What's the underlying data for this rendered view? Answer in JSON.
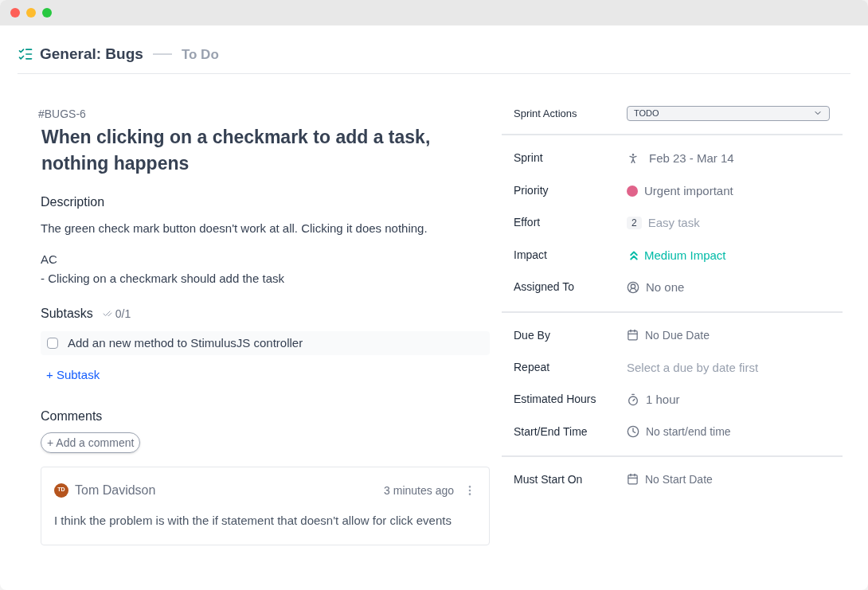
{
  "header": {
    "title": "General: Bugs",
    "status": "To Do"
  },
  "task": {
    "key": "#BUGS-6",
    "title": "When clicking on a checkmark to add a task, nothing happens",
    "description_heading": "Description",
    "description": [
      "The green check mark button doesn't work at all. Clicking it does nothing.",
      "AC",
      "- Clicking on a checkmark should add the task"
    ]
  },
  "subtasks": {
    "heading": "Subtasks",
    "count": "0/1",
    "items": [
      {
        "label": "Add an new method to StimulusJS controller",
        "checked": false
      }
    ],
    "add_button": "+ Subtask"
  },
  "comments": {
    "heading": "Comments",
    "add_button": "+ Add a comment",
    "items": [
      {
        "initials": "TD",
        "author": "Tom Davidson",
        "time": "3 minutes ago",
        "text": "I think the problem is with the if statement that doesn't allow for click events"
      }
    ]
  },
  "sprint_actions": {
    "label": "Sprint Actions",
    "value": "TODO"
  },
  "property_groups": [
    [
      {
        "kind": "sprint",
        "label": "Sprint",
        "value": "Feb 23 - Mar 14"
      },
      {
        "kind": "priority",
        "label": "Priority",
        "value": "Urgent important",
        "color": "#e0638a"
      },
      {
        "kind": "effort",
        "label": "Effort",
        "badge": "2",
        "value": "Easy task"
      },
      {
        "kind": "impact",
        "label": "Impact",
        "value": "Medium Impact"
      },
      {
        "kind": "assignee",
        "label": "Assigned To",
        "value": "No one"
      }
    ],
    [
      {
        "kind": "date",
        "label": "Due By",
        "value": "No Due Date"
      },
      {
        "kind": "text",
        "label": "Repeat",
        "value": "Select a due by date first"
      },
      {
        "kind": "timer",
        "label": "Estimated Hours",
        "value": "1 hour"
      },
      {
        "kind": "clock",
        "label": "Start/End Time",
        "value": "No start/end time"
      }
    ],
    [
      {
        "kind": "date",
        "label": "Must Start On",
        "value": "No Start Date"
      }
    ]
  ]
}
